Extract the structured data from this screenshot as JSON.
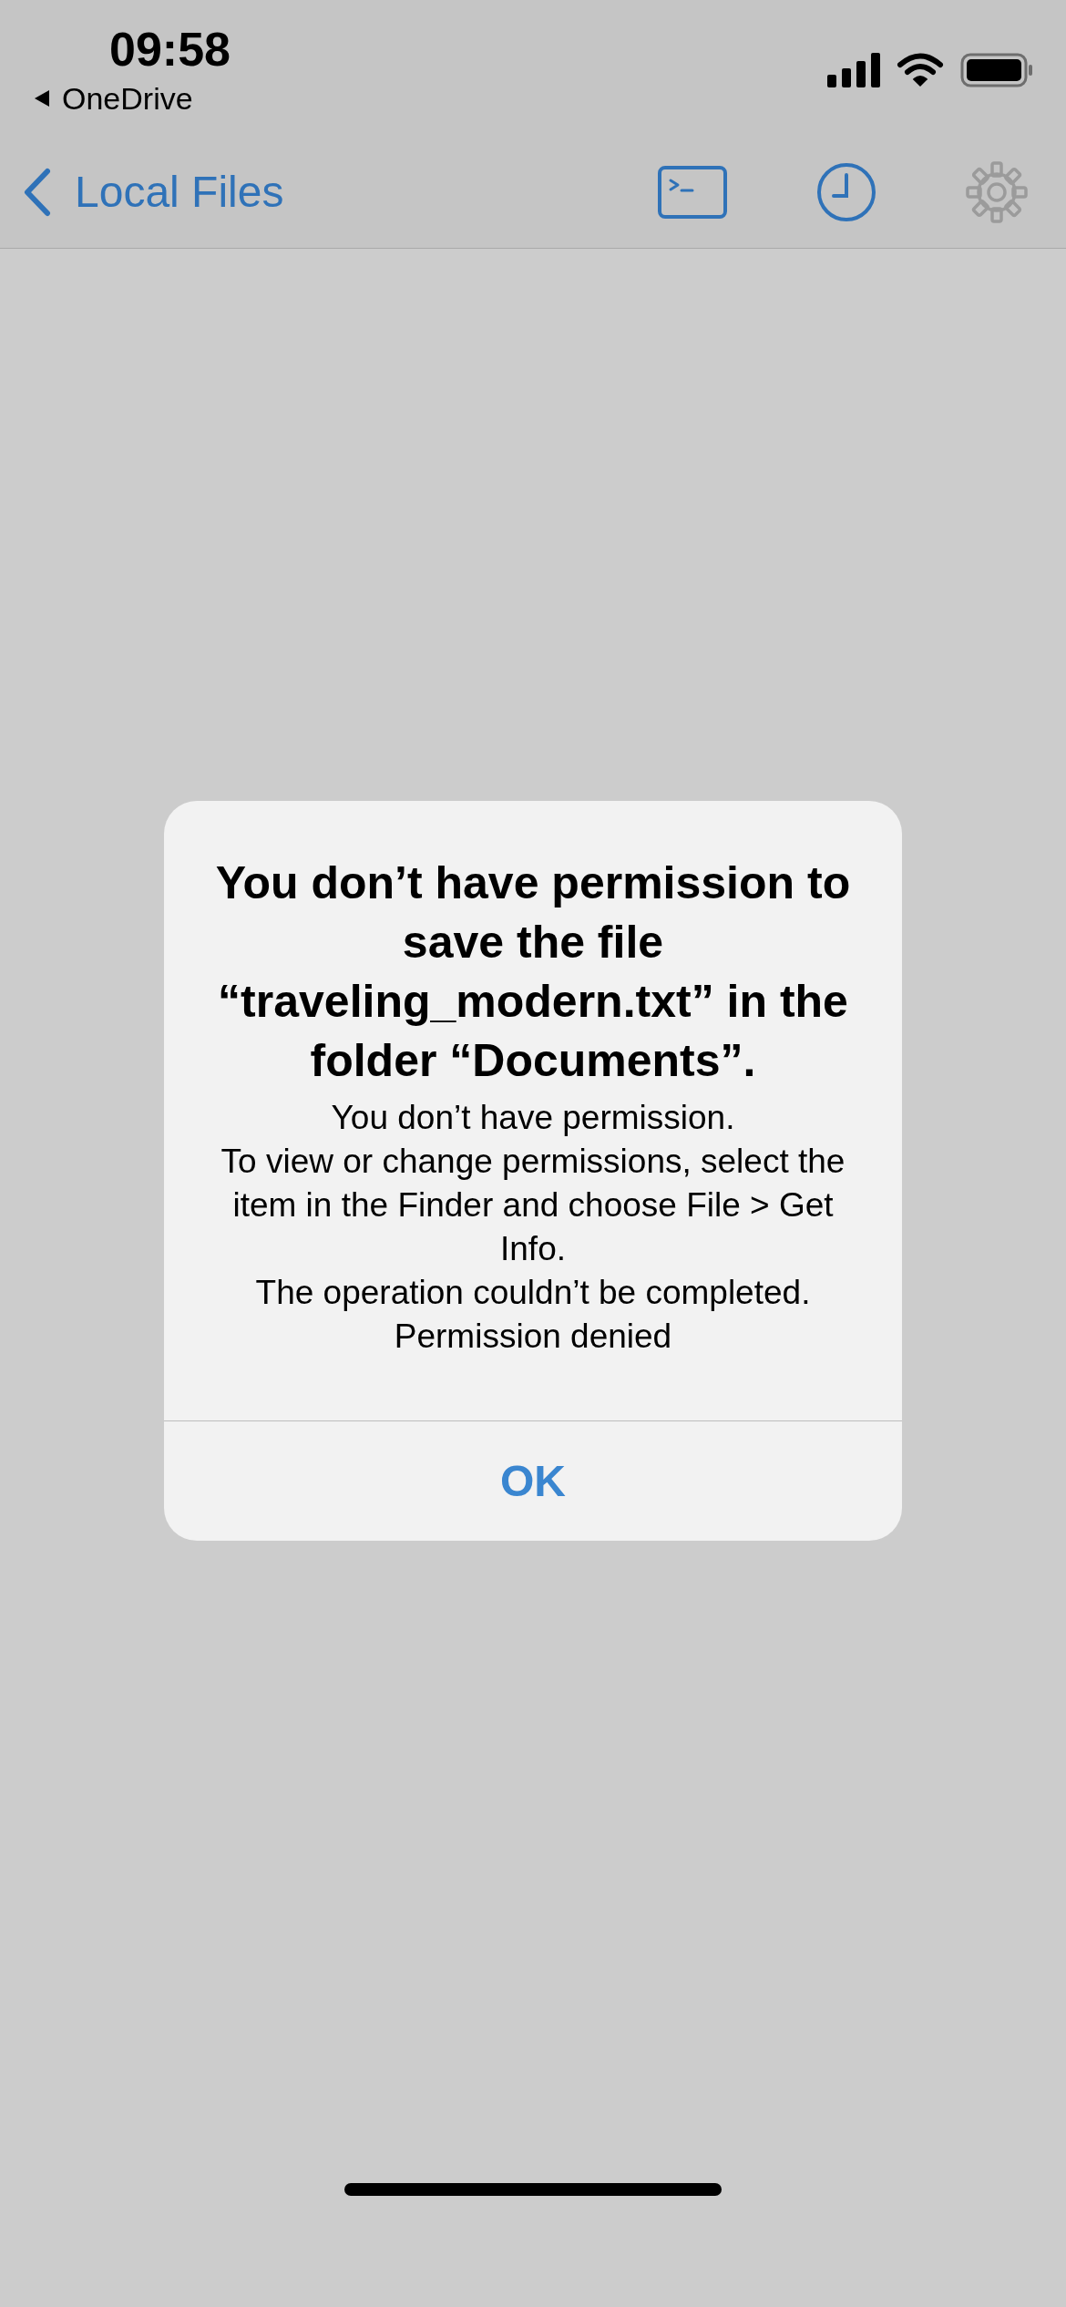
{
  "status_bar": {
    "time": "09:58",
    "back_app": "OneDrive"
  },
  "nav_bar": {
    "back_label": "Local Files",
    "tools": [
      {
        "kind": "terminal",
        "disabled": false
      },
      {
        "kind": "history",
        "disabled": false
      },
      {
        "kind": "settings",
        "disabled": true
      }
    ]
  },
  "alert": {
    "title": "You don’t have permission to save the file “traveling_modern.txt” in the folder “Documents”.",
    "message_lines": [
      "You don’t have permission.",
      "To view or change permissions, select the item in the Finder and choose File > Get Info.",
      "The operation couldn’t be completed.",
      "Permission denied"
    ],
    "buttons": [
      "OK"
    ]
  }
}
